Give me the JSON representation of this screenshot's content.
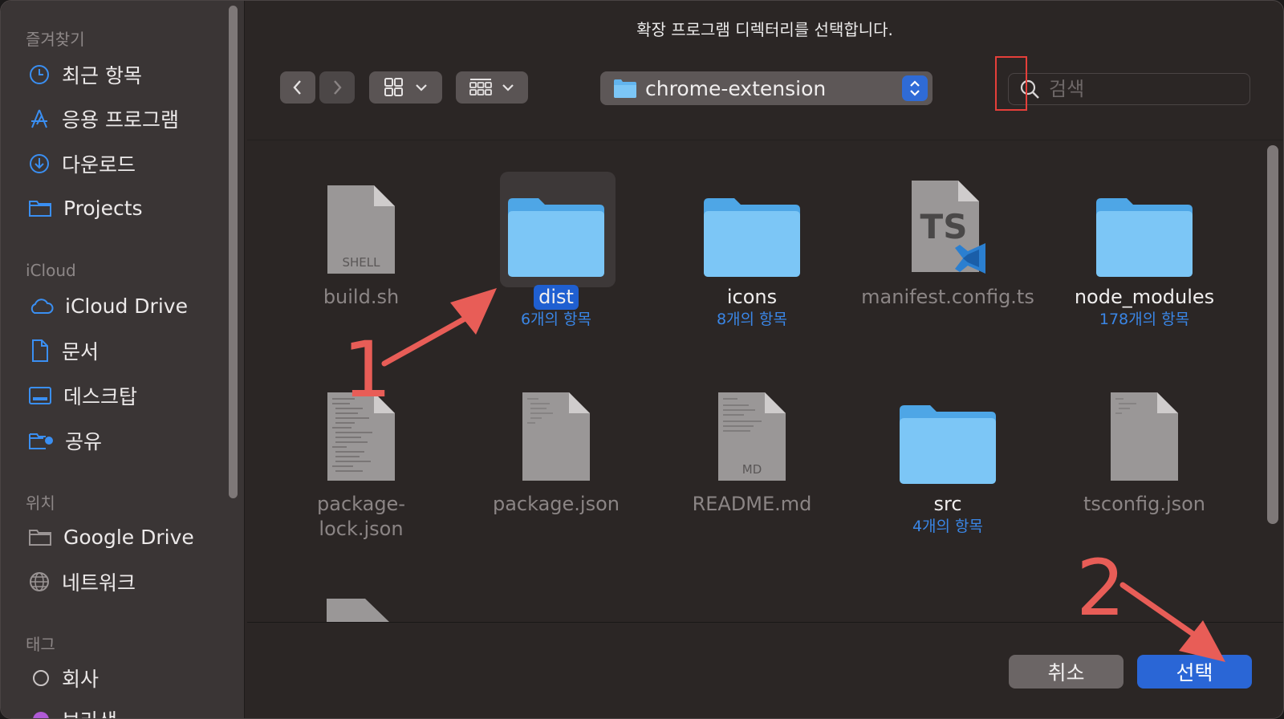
{
  "window": {
    "title": "확장 프로그램 디렉터리를 선택합니다."
  },
  "sidebar": {
    "favorites_header": "즐겨찾기",
    "favorites": [
      {
        "label": "최근 항목",
        "icon": "clock-icon"
      },
      {
        "label": "응용 프로그램",
        "icon": "applications-icon"
      },
      {
        "label": "다운로드",
        "icon": "download-icon"
      },
      {
        "label": "Projects",
        "icon": "folder-icon"
      }
    ],
    "icloud_header": "iCloud",
    "icloud": [
      {
        "label": "iCloud Drive",
        "icon": "cloud-icon"
      },
      {
        "label": "문서",
        "icon": "document-icon"
      },
      {
        "label": "데스크탑",
        "icon": "desktop-icon"
      },
      {
        "label": "공유",
        "icon": "shared-folder-icon"
      }
    ],
    "locations_header": "위치",
    "locations": [
      {
        "label": "Google Drive",
        "icon": "folder-icon"
      },
      {
        "label": "네트워크",
        "icon": "globe-icon"
      }
    ],
    "tags_header": "태그",
    "tags": [
      {
        "label": "회사",
        "icon": "tag-circle-icon"
      },
      {
        "label": "보라색",
        "icon": "tag-circle-icon",
        "color": "#b05ad6"
      }
    ]
  },
  "toolbar": {
    "path": "chrome-extension",
    "search_placeholder": "검색"
  },
  "files": [
    {
      "name": "build.sh",
      "kind": "shell",
      "badge": "SHELL"
    },
    {
      "name": "dist",
      "kind": "folder",
      "count": "6개의 항목",
      "selected": true
    },
    {
      "name": "icons",
      "kind": "folder",
      "count": "8개의 항목"
    },
    {
      "name": "manifest.config.ts",
      "kind": "ts",
      "badge": "TS"
    },
    {
      "name": "node_modules",
      "kind": "folder",
      "count": "178개의 항목"
    },
    {
      "name": "package-lock.json",
      "kind": "doc",
      "line1": "package-",
      "line2": "lock.json"
    },
    {
      "name": "package.json",
      "kind": "doc"
    },
    {
      "name": "README.md",
      "kind": "md",
      "badge": "MD"
    },
    {
      "name": "src",
      "kind": "folder",
      "count": "4개의 항목"
    },
    {
      "name": "tsconfig.json",
      "kind": "doc"
    }
  ],
  "buttons": {
    "cancel": "취소",
    "choose": "선택"
  },
  "annotations": {
    "step1": "1",
    "step2": "2",
    "color": "#e85d57"
  },
  "colors": {
    "accent": "#2a66d6",
    "folder": "#6cc0f5",
    "annotation": "#e53f3a"
  }
}
